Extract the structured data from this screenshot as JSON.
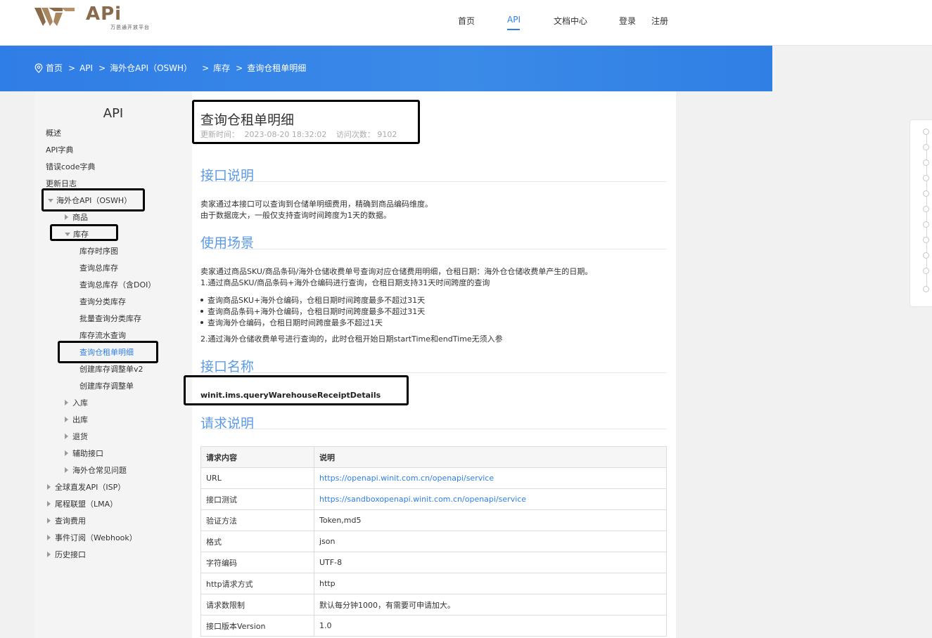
{
  "header": {
    "logo_text": "Wi API",
    "logo_sub": "万邑通开放平台",
    "nav": [
      "首页",
      "API",
      "文档中心"
    ],
    "login": "登录",
    "register": "注册",
    "accent": "#2f7fe5"
  },
  "breadcrumb": {
    "icon": "location-pin-icon",
    "items": [
      "首页",
      "API",
      "海外仓API（OSWH）",
      "库存",
      "查询仓租单明细"
    ],
    "separator": ">"
  },
  "sidebar": {
    "title": "API",
    "top_items": [
      "概述",
      "API字典",
      "错误code字典",
      "更新日志"
    ],
    "oswh": "海外仓API（OSWH）",
    "goods": "商品",
    "stock": "库存",
    "stock_children": [
      "库存时序图",
      "查询总库存",
      "查询总库存（含DOI）",
      "查询分类库存",
      "批量查询分类库存",
      "库存流水查询",
      "查询仓租单明细",
      "创建库存调整单v2",
      "创建库存调整单"
    ],
    "oswh_rest": [
      "入库",
      "出库",
      "退货",
      "辅助接口",
      "海外仓常见问题"
    ],
    "bottom_items": [
      "全球直发API（ISP）",
      "尾程联盟（LMA）",
      "查询费用",
      "事件订阅（Webhook）",
      "历史接口"
    ]
  },
  "content": {
    "title": "查询仓租单明细",
    "update_label": "更新时间：",
    "update_time": "2023-08-20 18:32:02",
    "visits_label": "访问次数：",
    "visits": "9102",
    "sec_desc": "接口说明",
    "desc_lines": [
      "卖家通过本接口可以查询到仓储单明细费用，精确到商品编码维度。",
      "由于数据庞大，一般仅支持查询时间跨度为1天的数据。"
    ],
    "sec_scene": "使用场景",
    "scene_line1": "卖家通过商品SKU/商品条码/海外仓储收费单号查询对应仓储费用明细，仓租日期：海外仓仓储收费单产生的日期。",
    "scene_line2": "1.通过商品SKU/商品条码+海外仓编码进行查询，仓租日期支持31天时间跨度的查询",
    "scene_bullets": [
      "查询商品SKU+海外仓编码，仓租日期时间跨度最多不超过31天",
      "查询商品条码+海外仓编码，仓租日期时间跨度最多不超过31天",
      "查询海外仓编码，仓租日期时间跨度最多不超过1天"
    ],
    "scene_line3": "2.通过海外仓储收费单号进行查询的，此时仓租开始日期startTime和endTime无须入参",
    "sec_name": "接口名称",
    "api_name": "winit.ims.queryWarehouseReceiptDetails",
    "sec_req": "请求说明",
    "table_headers": [
      "请求内容",
      "说明"
    ],
    "table_rows": [
      [
        "URL",
        "https://openapi.winit.com.cn/openapi/service"
      ],
      [
        "接口测试",
        "https://sandboxopenapi.winit.com.cn/openapi/service"
      ],
      [
        "验证方法",
        "Token,md5"
      ],
      [
        "格式",
        "json"
      ],
      [
        "字符编码",
        "UTF-8"
      ],
      [
        "http请求方式",
        "http"
      ],
      [
        "请求数限制",
        "默认每分钟1000，有需要可申请加大。"
      ],
      [
        "接口版本Version",
        "1.0"
      ]
    ]
  }
}
